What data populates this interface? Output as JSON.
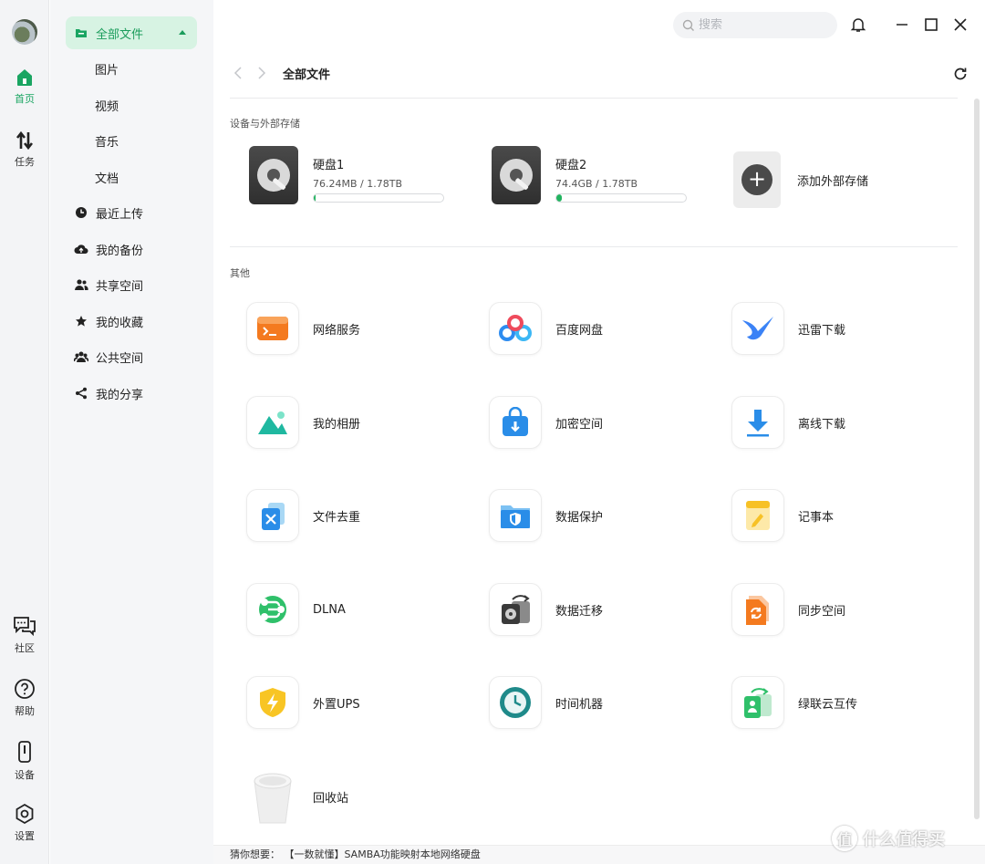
{
  "rail": {
    "home": "首页",
    "tasks": "任务",
    "community": "社区",
    "help": "帮助",
    "devices": "设备",
    "settings": "设置"
  },
  "nav": {
    "all_files": "全部文件",
    "pictures": "图片",
    "videos": "视频",
    "music": "音乐",
    "documents": "文档",
    "recent_uploads": "最近上传",
    "my_backup": "我的备份",
    "shared_space": "共享空间",
    "my_favorites": "我的收藏",
    "public_space": "公共空间",
    "my_shares": "我的分享"
  },
  "search": {
    "placeholder": "搜索"
  },
  "header": {
    "title": "全部文件"
  },
  "storage_section": {
    "title": "设备与外部存储",
    "disks": [
      {
        "name": "硬盘1",
        "size": "76.24MB / 1.78TB",
        "usage_fraction": 0.0001
      },
      {
        "name": "硬盘2",
        "size": "74.4GB / 1.78TB",
        "usage_fraction": 0.04
      }
    ],
    "add_external": "添加外部存储"
  },
  "other_section": {
    "title": "其他",
    "apps": [
      "网络服务",
      "百度网盘",
      "迅雷下载",
      "我的相册",
      "加密空间",
      "离线下载",
      "文件去重",
      "数据保护",
      "记事本",
      "DLNA",
      "数据迁移",
      "同步空间",
      "外置UPS",
      "时间机器",
      "绿联云互传",
      "回收站"
    ]
  },
  "footer": {
    "prefix": "猜你想要：",
    "link": "【一数就懂】SAMBA功能映射本地网络硬盘"
  },
  "watermark": {
    "text": "什么值得买",
    "glyph": "值"
  },
  "colors": {
    "accent": "#1aa562",
    "active_bg": "#d7f3e3"
  }
}
